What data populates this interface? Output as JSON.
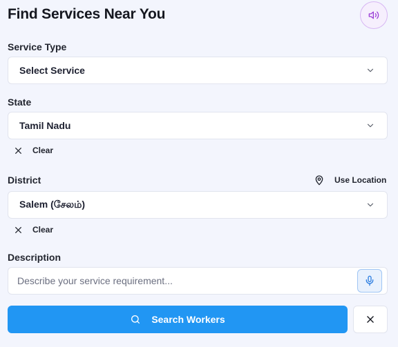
{
  "header": {
    "title": "Find Services Near You",
    "speaker_icon": "speaker-icon"
  },
  "service_type": {
    "label": "Service Type",
    "value": "Select Service"
  },
  "state": {
    "label": "State",
    "value": "Tamil Nadu",
    "clear_label": "Clear"
  },
  "district": {
    "label": "District",
    "use_location_label": "Use Location",
    "value": "Salem (சேலம்)",
    "clear_label": "Clear"
  },
  "description": {
    "label": "Description",
    "placeholder": "Describe your service requirement...",
    "value": ""
  },
  "actions": {
    "search_label": "Search Workers"
  },
  "colors": {
    "primary": "#2196f3",
    "speaker_border": "#d7b6f3",
    "mic_border": "#9fc5f4",
    "background": "#f3f5fd"
  }
}
